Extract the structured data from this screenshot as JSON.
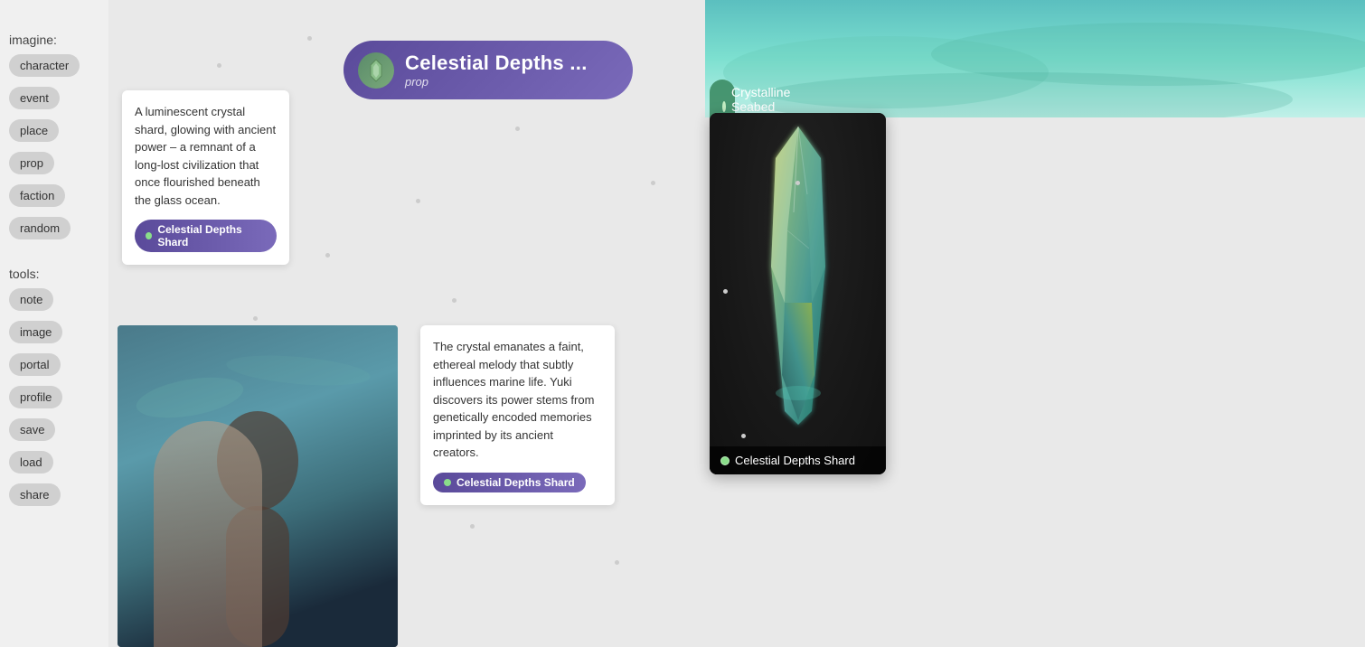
{
  "sidebar": {
    "imagine_label": "imagine:",
    "tools_label": "tools:",
    "imagine_buttons": [
      {
        "id": "character",
        "label": "character"
      },
      {
        "id": "event",
        "label": "event"
      },
      {
        "id": "place",
        "label": "place"
      },
      {
        "id": "prop",
        "label": "prop"
      },
      {
        "id": "faction",
        "label": "faction"
      },
      {
        "id": "random",
        "label": "random"
      }
    ],
    "tools_buttons": [
      {
        "id": "note",
        "label": "note"
      },
      {
        "id": "image",
        "label": "image"
      },
      {
        "id": "portal",
        "label": "portal"
      },
      {
        "id": "profile",
        "label": "profile"
      },
      {
        "id": "save",
        "label": "save"
      },
      {
        "id": "load",
        "label": "load"
      },
      {
        "id": "share",
        "label": "share"
      }
    ]
  },
  "header": {
    "title": "Celestial Depths ...",
    "subtitle": "prop"
  },
  "location": {
    "name": "Crystalline Seabed Catacombs"
  },
  "note1": {
    "text": "A luminescent crystal shard, glowing with ancient power – a remnant of a long-lost civilization that once flourished beneath the glass ocean.",
    "badge_label": "Celestial Depths Shard"
  },
  "note2": {
    "text": "The crystal emanates a faint, ethereal melody that subtly influences marine life. Yuki discovers its power stems from genetically encoded memories imprinted by its ancient creators.",
    "badge_label": "Celestial Depths Shard"
  },
  "crystal_card": {
    "badge_label": "Celestial Depths Shard"
  }
}
